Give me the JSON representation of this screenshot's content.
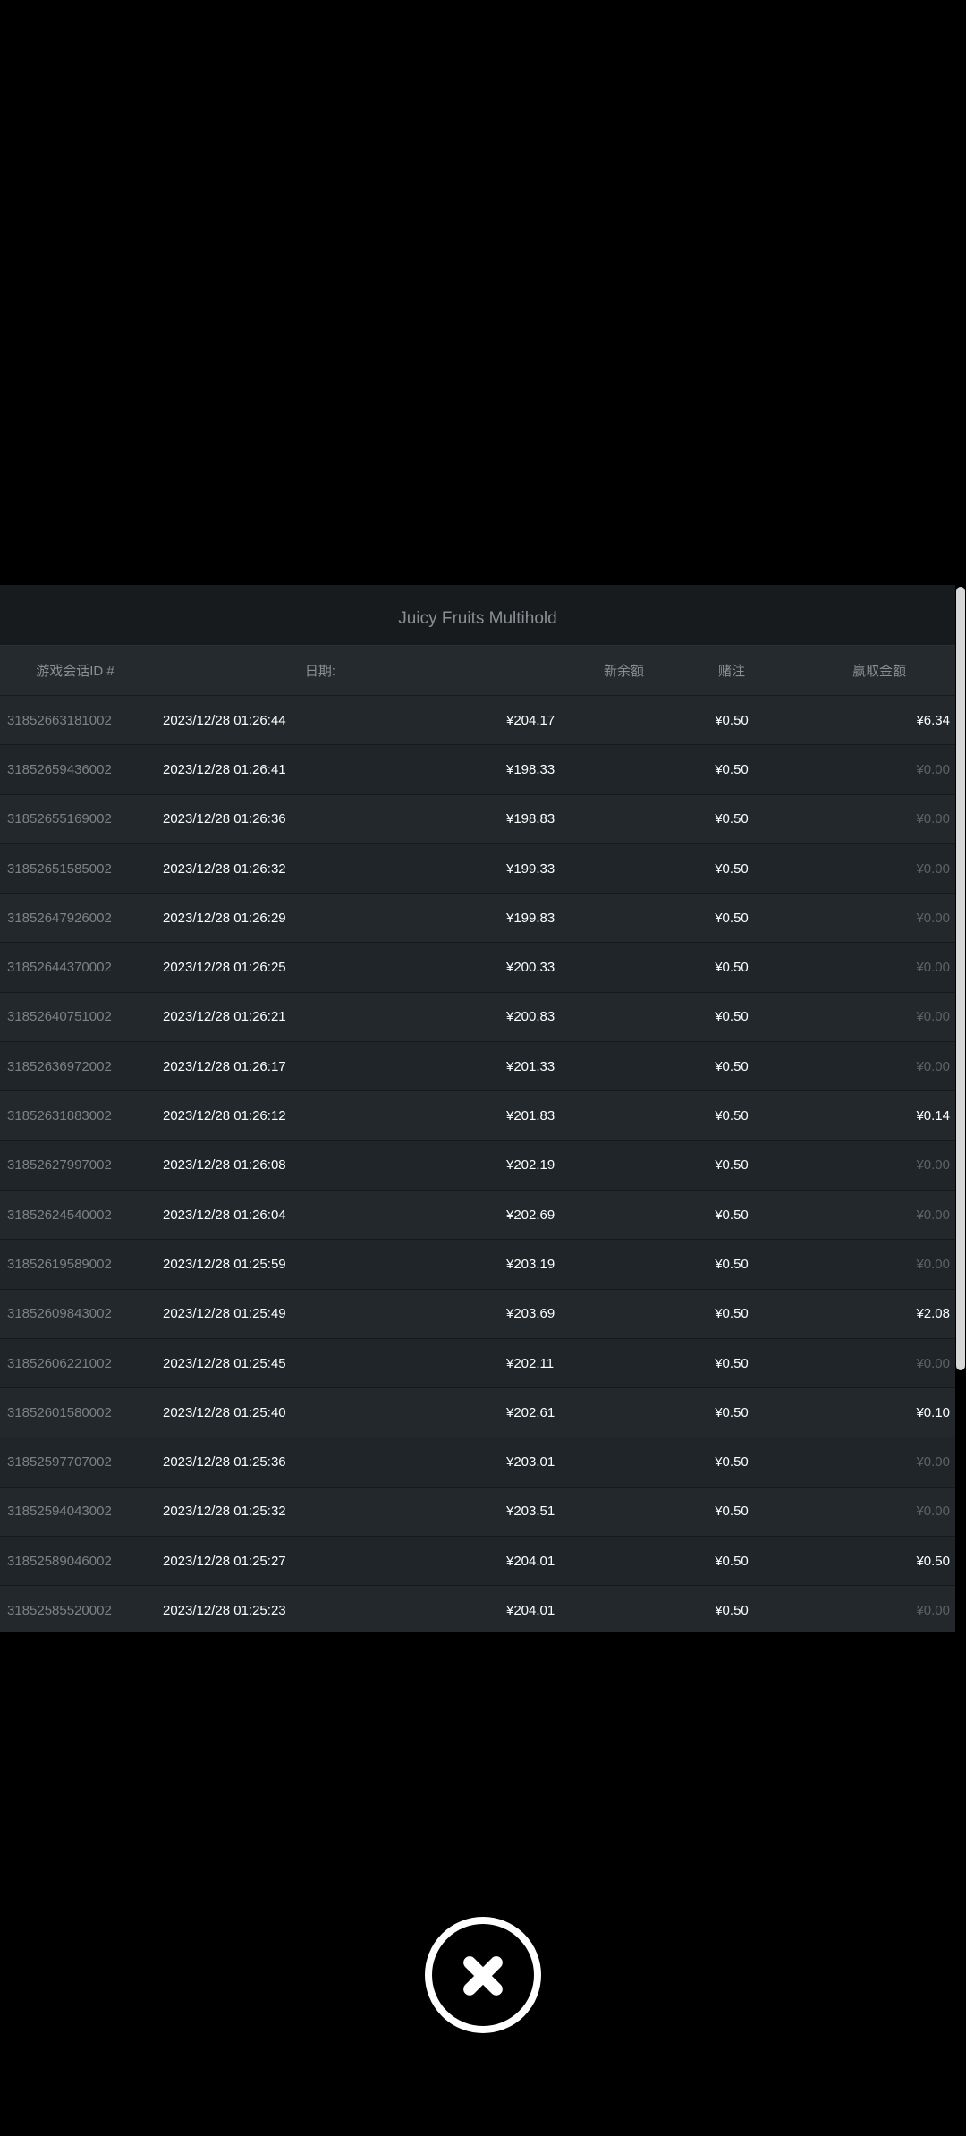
{
  "title": "Juicy Fruits Multihold",
  "headers": {
    "id": "游戏会话ID #",
    "date": "日期:",
    "balance": "新余额",
    "bet": "赌注",
    "win": "赢取金额"
  },
  "rows": [
    {
      "id": "31852663181002",
      "date": "2023/12/28 01:26:44",
      "balance": "¥204.17",
      "bet": "¥0.50",
      "win": "¥6.34"
    },
    {
      "id": "31852659436002",
      "date": "2023/12/28 01:26:41",
      "balance": "¥198.33",
      "bet": "¥0.50",
      "win": "¥0.00"
    },
    {
      "id": "31852655169002",
      "date": "2023/12/28 01:26:36",
      "balance": "¥198.83",
      "bet": "¥0.50",
      "win": "¥0.00"
    },
    {
      "id": "31852651585002",
      "date": "2023/12/28 01:26:32",
      "balance": "¥199.33",
      "bet": "¥0.50",
      "win": "¥0.00"
    },
    {
      "id": "31852647926002",
      "date": "2023/12/28 01:26:29",
      "balance": "¥199.83",
      "bet": "¥0.50",
      "win": "¥0.00"
    },
    {
      "id": "31852644370002",
      "date": "2023/12/28 01:26:25",
      "balance": "¥200.33",
      "bet": "¥0.50",
      "win": "¥0.00"
    },
    {
      "id": "31852640751002",
      "date": "2023/12/28 01:26:21",
      "balance": "¥200.83",
      "bet": "¥0.50",
      "win": "¥0.00"
    },
    {
      "id": "31852636972002",
      "date": "2023/12/28 01:26:17",
      "balance": "¥201.33",
      "bet": "¥0.50",
      "win": "¥0.00"
    },
    {
      "id": "31852631883002",
      "date": "2023/12/28 01:26:12",
      "balance": "¥201.83",
      "bet": "¥0.50",
      "win": "¥0.14"
    },
    {
      "id": "31852627997002",
      "date": "2023/12/28 01:26:08",
      "balance": "¥202.19",
      "bet": "¥0.50",
      "win": "¥0.00"
    },
    {
      "id": "31852624540002",
      "date": "2023/12/28 01:26:04",
      "balance": "¥202.69",
      "bet": "¥0.50",
      "win": "¥0.00"
    },
    {
      "id": "31852619589002",
      "date": "2023/12/28 01:25:59",
      "balance": "¥203.19",
      "bet": "¥0.50",
      "win": "¥0.00"
    },
    {
      "id": "31852609843002",
      "date": "2023/12/28 01:25:49",
      "balance": "¥203.69",
      "bet": "¥0.50",
      "win": "¥2.08"
    },
    {
      "id": "31852606221002",
      "date": "2023/12/28 01:25:45",
      "balance": "¥202.11",
      "bet": "¥0.50",
      "win": "¥0.00"
    },
    {
      "id": "31852601580002",
      "date": "2023/12/28 01:25:40",
      "balance": "¥202.61",
      "bet": "¥0.50",
      "win": "¥0.10"
    },
    {
      "id": "31852597707002",
      "date": "2023/12/28 01:25:36",
      "balance": "¥203.01",
      "bet": "¥0.50",
      "win": "¥0.00"
    },
    {
      "id": "31852594043002",
      "date": "2023/12/28 01:25:32",
      "balance": "¥203.51",
      "bet": "¥0.50",
      "win": "¥0.00"
    },
    {
      "id": "31852589046002",
      "date": "2023/12/28 01:25:27",
      "balance": "¥204.01",
      "bet": "¥0.50",
      "win": "¥0.50"
    },
    {
      "id": "31852585520002",
      "date": "2023/12/28 01:25:23",
      "balance": "¥204.01",
      "bet": "¥0.50",
      "win": "¥0.00"
    }
  ],
  "icons": {
    "close": "close-icon"
  },
  "colors": {
    "background": "#000000",
    "panel": "#1f2528",
    "title_bar": "#181b1d",
    "muted_text": "#7d8286",
    "zero_win_text": "#5d6266",
    "text": "#ffffff"
  }
}
